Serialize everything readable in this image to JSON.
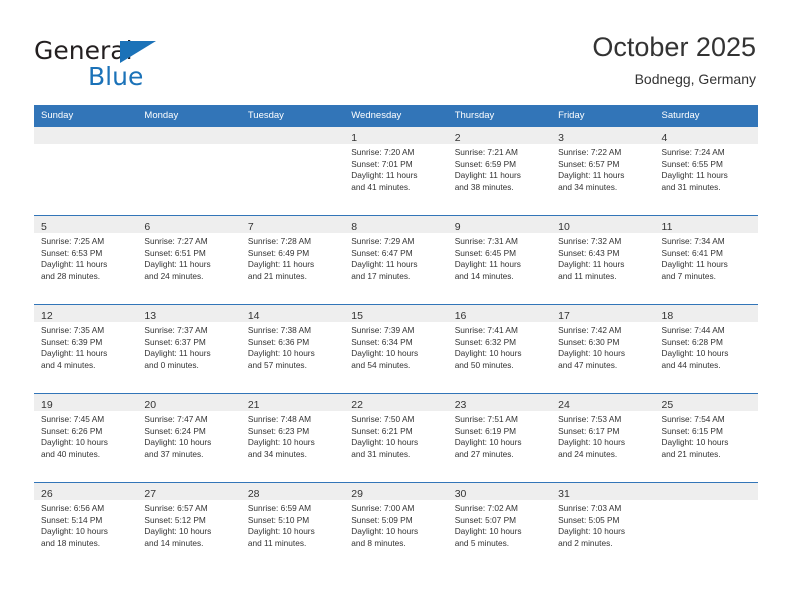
{
  "brand": {
    "name_part1": "General",
    "name_part2": "Blue",
    "accent_color": "#1b72b8",
    "triangle_icon": "triangle-icon"
  },
  "header": {
    "title": "October 2025",
    "subtitle": "Bodnegg, Germany"
  },
  "theme": {
    "header_blue": "#3275b8",
    "daynum_strip": "#eeeeee",
    "text": "#333333"
  },
  "weekdays": [
    "Sunday",
    "Monday",
    "Tuesday",
    "Wednesday",
    "Thursday",
    "Friday",
    "Saturday"
  ],
  "weeks": [
    [
      {
        "day": "",
        "empty": true,
        "sunrise": "",
        "sunset": "",
        "daylight1": "",
        "daylight2": ""
      },
      {
        "day": "",
        "empty": true,
        "sunrise": "",
        "sunset": "",
        "daylight1": "",
        "daylight2": ""
      },
      {
        "day": "",
        "empty": true,
        "sunrise": "",
        "sunset": "",
        "daylight1": "",
        "daylight2": ""
      },
      {
        "day": "1",
        "empty": false,
        "sunrise": "Sunrise: 7:20 AM",
        "sunset": "Sunset: 7:01 PM",
        "daylight1": "Daylight: 11 hours",
        "daylight2": "and 41 minutes."
      },
      {
        "day": "2",
        "empty": false,
        "sunrise": "Sunrise: 7:21 AM",
        "sunset": "Sunset: 6:59 PM",
        "daylight1": "Daylight: 11 hours",
        "daylight2": "and 38 minutes."
      },
      {
        "day": "3",
        "empty": false,
        "sunrise": "Sunrise: 7:22 AM",
        "sunset": "Sunset: 6:57 PM",
        "daylight1": "Daylight: 11 hours",
        "daylight2": "and 34 minutes."
      },
      {
        "day": "4",
        "empty": false,
        "sunrise": "Sunrise: 7:24 AM",
        "sunset": "Sunset: 6:55 PM",
        "daylight1": "Daylight: 11 hours",
        "daylight2": "and 31 minutes."
      }
    ],
    [
      {
        "day": "5",
        "empty": false,
        "sunrise": "Sunrise: 7:25 AM",
        "sunset": "Sunset: 6:53 PM",
        "daylight1": "Daylight: 11 hours",
        "daylight2": "and 28 minutes."
      },
      {
        "day": "6",
        "empty": false,
        "sunrise": "Sunrise: 7:27 AM",
        "sunset": "Sunset: 6:51 PM",
        "daylight1": "Daylight: 11 hours",
        "daylight2": "and 24 minutes."
      },
      {
        "day": "7",
        "empty": false,
        "sunrise": "Sunrise: 7:28 AM",
        "sunset": "Sunset: 6:49 PM",
        "daylight1": "Daylight: 11 hours",
        "daylight2": "and 21 minutes."
      },
      {
        "day": "8",
        "empty": false,
        "sunrise": "Sunrise: 7:29 AM",
        "sunset": "Sunset: 6:47 PM",
        "daylight1": "Daylight: 11 hours",
        "daylight2": "and 17 minutes."
      },
      {
        "day": "9",
        "empty": false,
        "sunrise": "Sunrise: 7:31 AM",
        "sunset": "Sunset: 6:45 PM",
        "daylight1": "Daylight: 11 hours",
        "daylight2": "and 14 minutes."
      },
      {
        "day": "10",
        "empty": false,
        "sunrise": "Sunrise: 7:32 AM",
        "sunset": "Sunset: 6:43 PM",
        "daylight1": "Daylight: 11 hours",
        "daylight2": "and 11 minutes."
      },
      {
        "day": "11",
        "empty": false,
        "sunrise": "Sunrise: 7:34 AM",
        "sunset": "Sunset: 6:41 PM",
        "daylight1": "Daylight: 11 hours",
        "daylight2": "and 7 minutes."
      }
    ],
    [
      {
        "day": "12",
        "empty": false,
        "sunrise": "Sunrise: 7:35 AM",
        "sunset": "Sunset: 6:39 PM",
        "daylight1": "Daylight: 11 hours",
        "daylight2": "and 4 minutes."
      },
      {
        "day": "13",
        "empty": false,
        "sunrise": "Sunrise: 7:37 AM",
        "sunset": "Sunset: 6:37 PM",
        "daylight1": "Daylight: 11 hours",
        "daylight2": "and 0 minutes."
      },
      {
        "day": "14",
        "empty": false,
        "sunrise": "Sunrise: 7:38 AM",
        "sunset": "Sunset: 6:36 PM",
        "daylight1": "Daylight: 10 hours",
        "daylight2": "and 57 minutes."
      },
      {
        "day": "15",
        "empty": false,
        "sunrise": "Sunrise: 7:39 AM",
        "sunset": "Sunset: 6:34 PM",
        "daylight1": "Daylight: 10 hours",
        "daylight2": "and 54 minutes."
      },
      {
        "day": "16",
        "empty": false,
        "sunrise": "Sunrise: 7:41 AM",
        "sunset": "Sunset: 6:32 PM",
        "daylight1": "Daylight: 10 hours",
        "daylight2": "and 50 minutes."
      },
      {
        "day": "17",
        "empty": false,
        "sunrise": "Sunrise: 7:42 AM",
        "sunset": "Sunset: 6:30 PM",
        "daylight1": "Daylight: 10 hours",
        "daylight2": "and 47 minutes."
      },
      {
        "day": "18",
        "empty": false,
        "sunrise": "Sunrise: 7:44 AM",
        "sunset": "Sunset: 6:28 PM",
        "daylight1": "Daylight: 10 hours",
        "daylight2": "and 44 minutes."
      }
    ],
    [
      {
        "day": "19",
        "empty": false,
        "sunrise": "Sunrise: 7:45 AM",
        "sunset": "Sunset: 6:26 PM",
        "daylight1": "Daylight: 10 hours",
        "daylight2": "and 40 minutes."
      },
      {
        "day": "20",
        "empty": false,
        "sunrise": "Sunrise: 7:47 AM",
        "sunset": "Sunset: 6:24 PM",
        "daylight1": "Daylight: 10 hours",
        "daylight2": "and 37 minutes."
      },
      {
        "day": "21",
        "empty": false,
        "sunrise": "Sunrise: 7:48 AM",
        "sunset": "Sunset: 6:23 PM",
        "daylight1": "Daylight: 10 hours",
        "daylight2": "and 34 minutes."
      },
      {
        "day": "22",
        "empty": false,
        "sunrise": "Sunrise: 7:50 AM",
        "sunset": "Sunset: 6:21 PM",
        "daylight1": "Daylight: 10 hours",
        "daylight2": "and 31 minutes."
      },
      {
        "day": "23",
        "empty": false,
        "sunrise": "Sunrise: 7:51 AM",
        "sunset": "Sunset: 6:19 PM",
        "daylight1": "Daylight: 10 hours",
        "daylight2": "and 27 minutes."
      },
      {
        "day": "24",
        "empty": false,
        "sunrise": "Sunrise: 7:53 AM",
        "sunset": "Sunset: 6:17 PM",
        "daylight1": "Daylight: 10 hours",
        "daylight2": "and 24 minutes."
      },
      {
        "day": "25",
        "empty": false,
        "sunrise": "Sunrise: 7:54 AM",
        "sunset": "Sunset: 6:15 PM",
        "daylight1": "Daylight: 10 hours",
        "daylight2": "and 21 minutes."
      }
    ],
    [
      {
        "day": "26",
        "empty": false,
        "sunrise": "Sunrise: 6:56 AM",
        "sunset": "Sunset: 5:14 PM",
        "daylight1": "Daylight: 10 hours",
        "daylight2": "and 18 minutes."
      },
      {
        "day": "27",
        "empty": false,
        "sunrise": "Sunrise: 6:57 AM",
        "sunset": "Sunset: 5:12 PM",
        "daylight1": "Daylight: 10 hours",
        "daylight2": "and 14 minutes."
      },
      {
        "day": "28",
        "empty": false,
        "sunrise": "Sunrise: 6:59 AM",
        "sunset": "Sunset: 5:10 PM",
        "daylight1": "Daylight: 10 hours",
        "daylight2": "and 11 minutes."
      },
      {
        "day": "29",
        "empty": false,
        "sunrise": "Sunrise: 7:00 AM",
        "sunset": "Sunset: 5:09 PM",
        "daylight1": "Daylight: 10 hours",
        "daylight2": "and 8 minutes."
      },
      {
        "day": "30",
        "empty": false,
        "sunrise": "Sunrise: 7:02 AM",
        "sunset": "Sunset: 5:07 PM",
        "daylight1": "Daylight: 10 hours",
        "daylight2": "and 5 minutes."
      },
      {
        "day": "31",
        "empty": false,
        "sunrise": "Sunrise: 7:03 AM",
        "sunset": "Sunset: 5:05 PM",
        "daylight1": "Daylight: 10 hours",
        "daylight2": "and 2 minutes."
      },
      {
        "day": "",
        "empty": true,
        "sunrise": "",
        "sunset": "",
        "daylight1": "",
        "daylight2": ""
      }
    ]
  ]
}
